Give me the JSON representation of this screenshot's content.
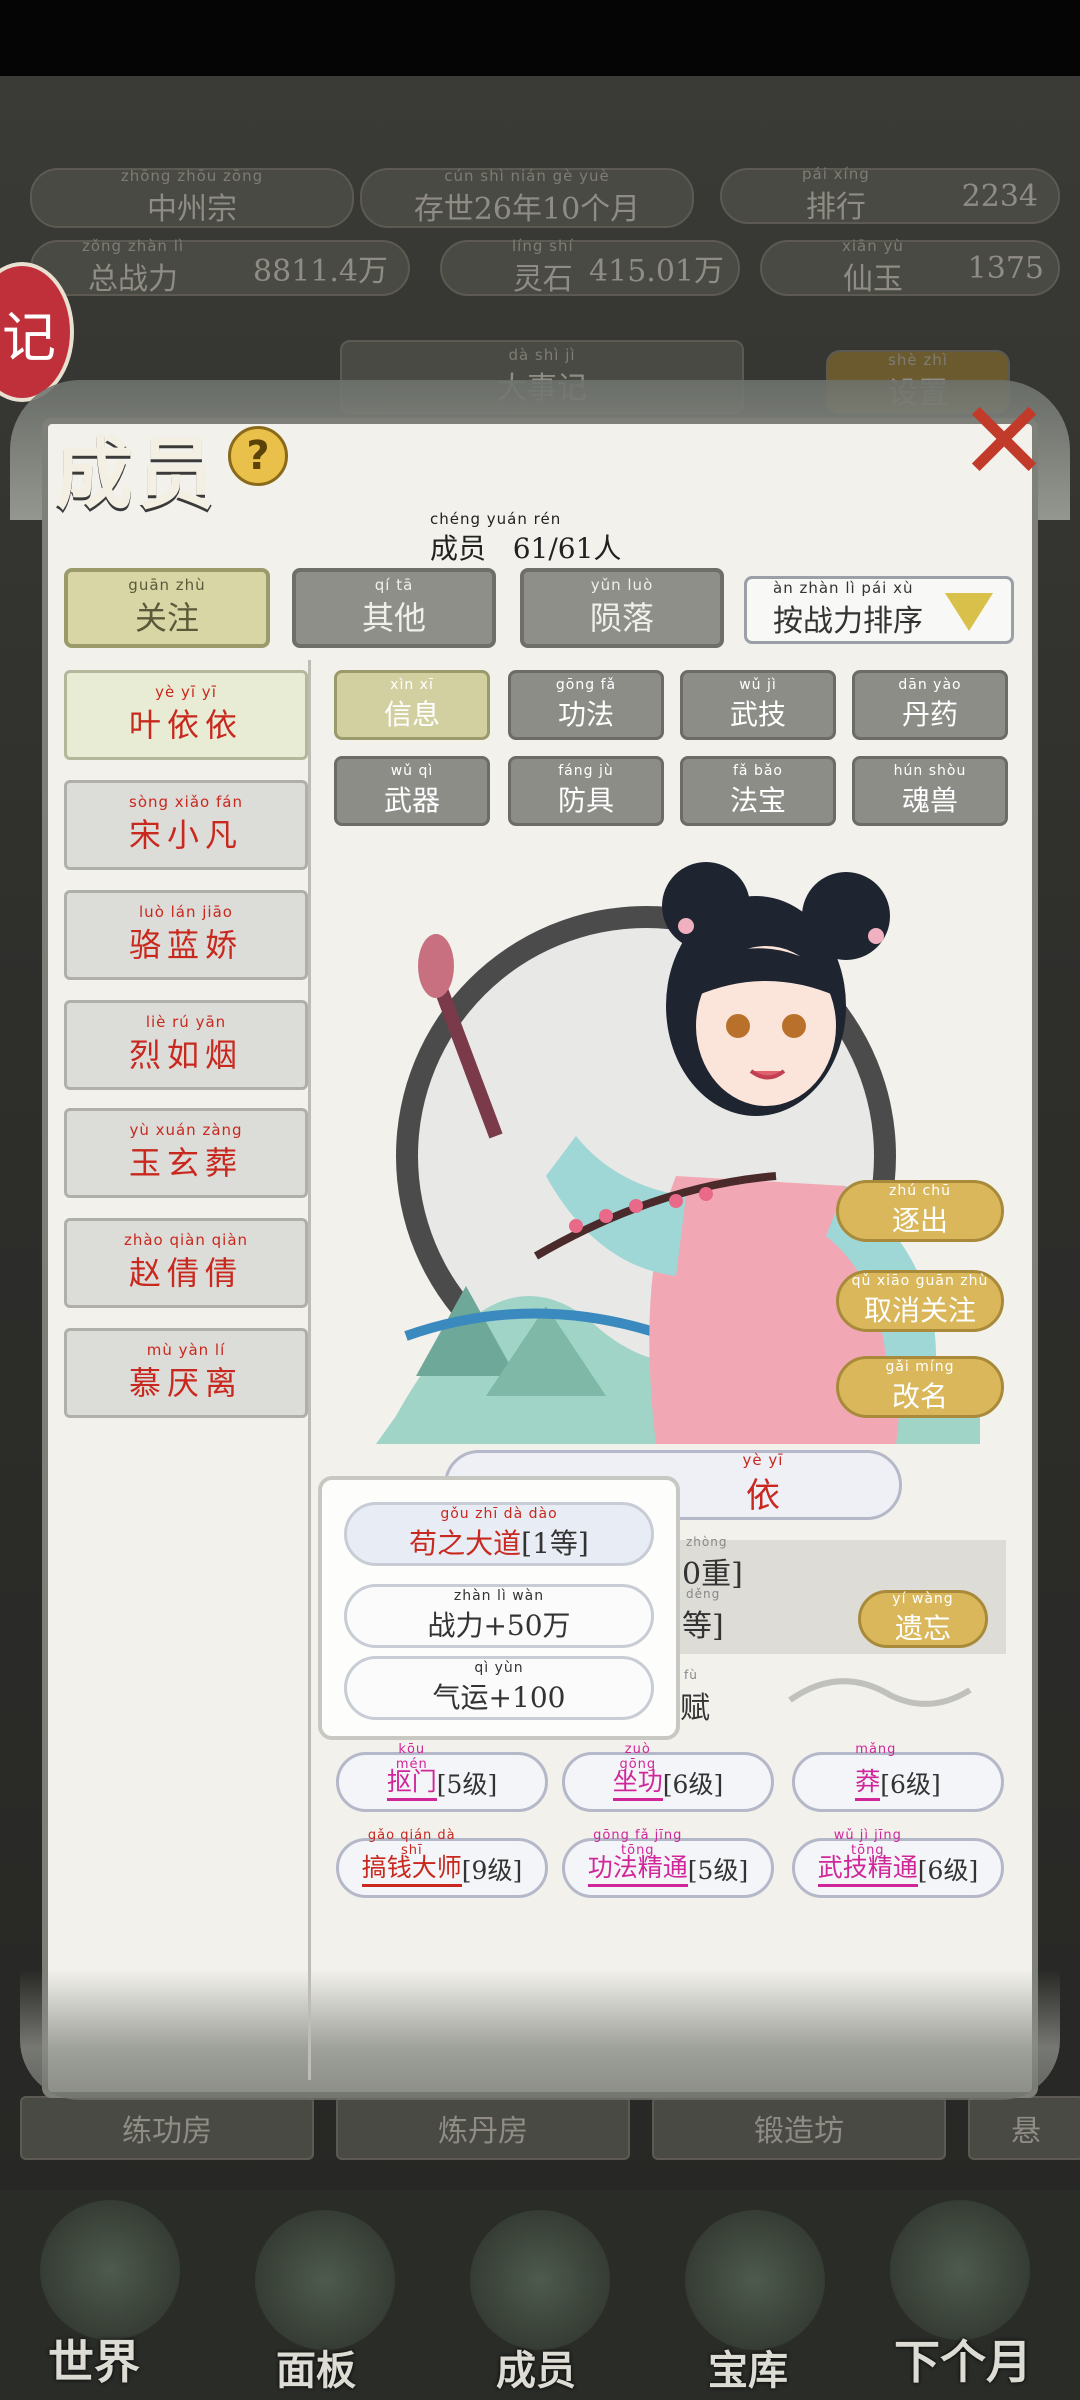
{
  "status_bar": {},
  "game_header": {
    "sect": {
      "pinyin": "zhōng zhōu zōng",
      "name": "中州宗"
    },
    "date": {
      "pinyin": "cún shì        nián       gè  yuè",
      "text": "存世26年10个月"
    },
    "rank": {
      "pinyin": "pái xíng",
      "label": "排行",
      "value": "2234"
    },
    "power": {
      "pinyin": "zǒng zhàn   lì",
      "label": "总战力",
      "value": "8811.4万",
      "unit_pinyin": "wàn"
    },
    "stones": {
      "pinyin": "líng shí",
      "label": "灵石",
      "value": "415.01万",
      "unit_pinyin": "wàn"
    },
    "jade": {
      "pinyin": "xiān  yù",
      "label": "仙玉",
      "value": "1375"
    },
    "record_badge": "记",
    "bg_center_tab": {
      "pinyin": "dà  shì  jì",
      "label": "大事记"
    },
    "bg_right_tab": {
      "pinyin": "shè zhì",
      "label": "设置"
    }
  },
  "bg_rooms": [
    "练功房",
    "炼丹房",
    "锻造坊",
    "悬"
  ],
  "bottom_nav": [
    {
      "label": "世界",
      "icon": "world-icon"
    },
    {
      "label": "面板",
      "icon": "panel-icon"
    },
    {
      "label": "成员",
      "icon": "member-icon"
    },
    {
      "label": "宝库",
      "icon": "treasury-icon"
    },
    {
      "label": "下个月",
      "icon": "next-month-icon"
    }
  ],
  "panel": {
    "title": "成员",
    "help_glyph": "?",
    "close_glyph": "✕",
    "count": {
      "pinyin": "chéng yuán                                rén",
      "label": "成员",
      "value": "61/61人"
    },
    "filter_tabs": [
      {
        "pinyin": "guān zhù",
        "label": "关注",
        "active": true
      },
      {
        "pinyin": "qí  tā",
        "label": "其他",
        "active": false
      },
      {
        "pinyin": "yǔn luò",
        "label": "陨落",
        "active": false
      }
    ],
    "sort": {
      "pinyin": "àn  zhàn  lì   pái  xù",
      "label": "按战力排序"
    },
    "members": [
      {
        "pinyin": "yè   yī   yī",
        "name": "叶依依",
        "active": true
      },
      {
        "pinyin": "sòng xiǎo  fán",
        "name": "宋小凡",
        "active": false
      },
      {
        "pinyin": "luò  lán  jiāo",
        "name": "骆蓝娇",
        "active": false
      },
      {
        "pinyin": "liè   rú   yān",
        "name": "烈如烟",
        "active": false
      },
      {
        "pinyin": "yù  xuán zàng",
        "name": "玉玄葬",
        "active": false
      },
      {
        "pinyin": "zhào qiàn qiàn",
        "name": "赵倩倩",
        "active": false
      },
      {
        "pinyin": "mù  yàn   lí",
        "name": "慕厌离",
        "active": false
      }
    ],
    "sub_tabs": [
      {
        "pinyin": "xìn  xī",
        "label": "信息",
        "active": true
      },
      {
        "pinyin": "gōng  fǎ",
        "label": "功法",
        "active": false
      },
      {
        "pinyin": "wǔ   jì",
        "label": "武技",
        "active": false
      },
      {
        "pinyin": "dān yào",
        "label": "丹药",
        "active": false
      },
      {
        "pinyin": "wǔ   qì",
        "label": "武器",
        "active": false
      },
      {
        "pinyin": "fáng  jù",
        "label": "防具",
        "active": false
      },
      {
        "pinyin": "fǎ  bǎo",
        "label": "法宝",
        "active": false
      },
      {
        "pinyin": "hún shòu",
        "label": "魂兽",
        "active": false
      }
    ],
    "actions": [
      {
        "pinyin": "zhú  chū",
        "label": "逐出"
      },
      {
        "pinyin": "qǔ  xiāo guān zhù",
        "label": "取消关注"
      },
      {
        "pinyin": "gǎi míng",
        "label": "改名"
      }
    ],
    "name_bar": {
      "pinyin": "yè    yī",
      "text": "依"
    },
    "info_rows": [
      {
        "text": "0重]",
        "pinyin": "zhòng"
      },
      {
        "text": "等]",
        "pinyin": "děng"
      },
      {
        "text": "赋",
        "pinyin": "fù"
      }
    ],
    "forget_button": {
      "pinyin": "yí wàng",
      "label": "遗忘"
    },
    "popup": [
      {
        "pinyin": "gǒu  zhī  dà  dào",
        "name": "苟之大道",
        "suffix": "[1等]",
        "suffix_pinyin": "děng"
      },
      {
        "pinyin": "zhàn   lì             wàn",
        "text": "战力+50万"
      },
      {
        "pinyin": "qì  yùn",
        "text": "气运+100"
      }
    ],
    "traits": [
      {
        "pinyin": "kōu mén",
        "name": "抠门",
        "level": "[5级]",
        "level_pinyin": "jí",
        "color": "#d0269a"
      },
      {
        "pinyin": "zuò gōng",
        "name": "坐功",
        "level": "[6级]",
        "level_pinyin": "jí",
        "color": "#d0269a"
      },
      {
        "pinyin": "mǎng",
        "name": "莽",
        "level": "[6级]",
        "level_pinyin": "jí",
        "color": "#d0269a"
      },
      {
        "pinyin": "gǎo qián  dà  shī",
        "name": "搞钱大师",
        "level": "[9级]",
        "level_pinyin": "jí",
        "color": "#c8281e"
      },
      {
        "pinyin": "gōng  fǎ  jīng tōng",
        "name": "功法精通",
        "level": "[5级]",
        "level_pinyin": "jí",
        "color": "#d0269a"
      },
      {
        "pinyin": "wǔ  jì  jīng tōng",
        "name": "武技精通",
        "level": "[6级]",
        "level_pinyin": "jí",
        "color": "#d0269a"
      }
    ]
  },
  "colors": {
    "accent_gold": "#d9b75a",
    "name_red": "#c8281e",
    "trait_pink": "#d0269a",
    "panel_bg": "#f2f1ec"
  }
}
